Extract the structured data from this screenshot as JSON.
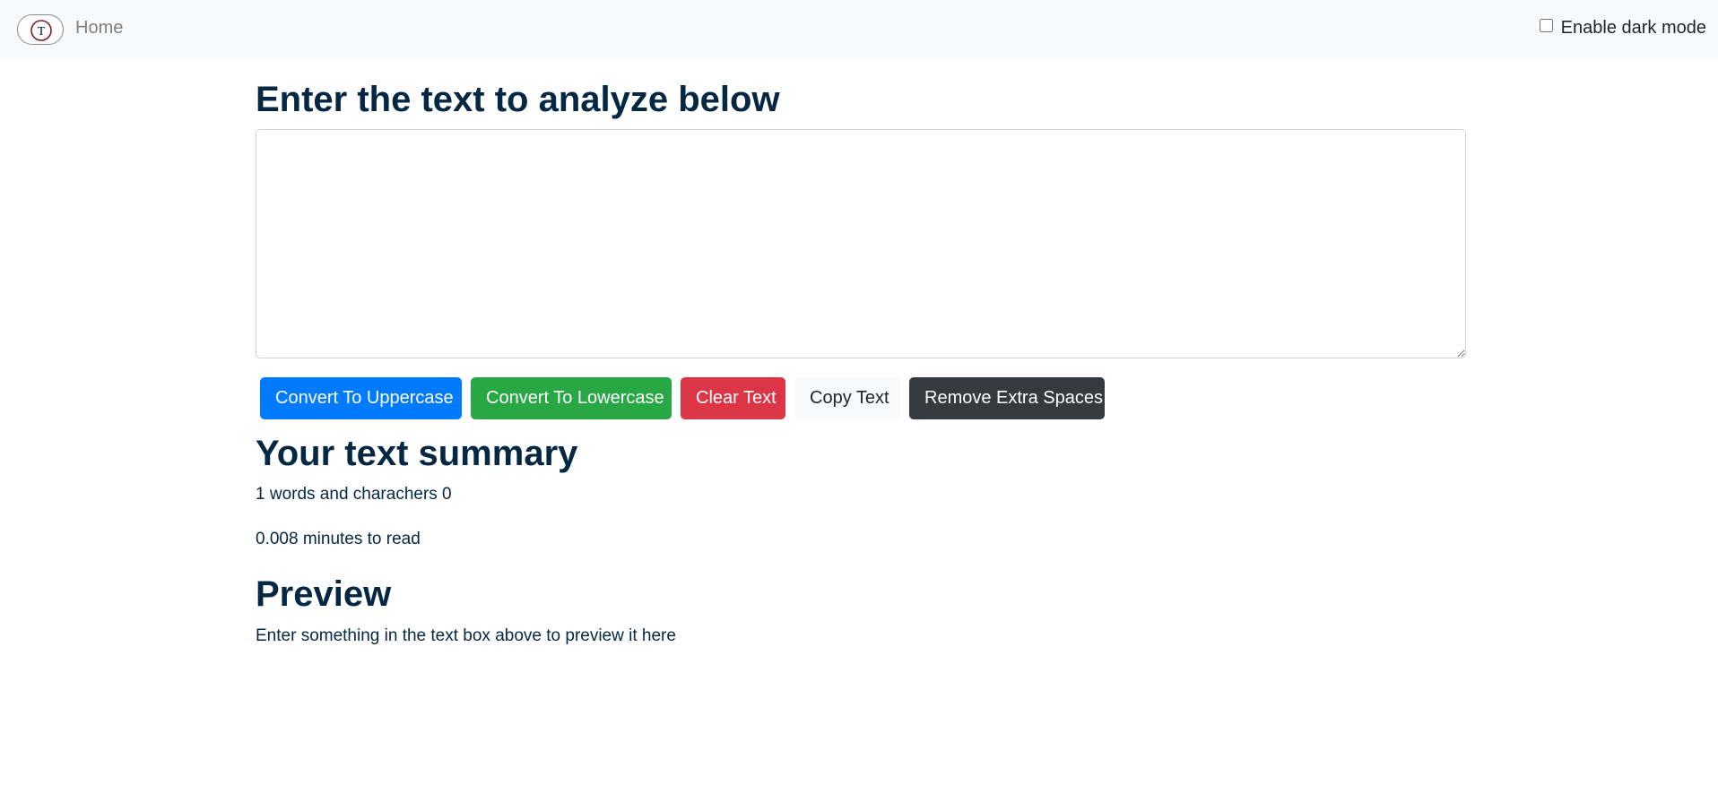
{
  "navbar": {
    "logo_icon": "text-utils-logo-icon",
    "logo_letter": "T",
    "home_label": "Home",
    "dark_mode_label": "Enable dark mode",
    "dark_mode_checked": false
  },
  "main": {
    "heading": "Enter the text to analyze below",
    "textarea_value": "",
    "buttons": {
      "uppercase": "Convert To Uppercase",
      "lowercase": "Convert To Lowercase",
      "clear": "Clear Text",
      "copy": "Copy Text",
      "remove_spaces": "Remove Extra Spaces"
    }
  },
  "summary": {
    "heading": "Your text summary",
    "words_line": "1 words and charachers 0",
    "read_time_line": "0.008 minutes to read"
  },
  "preview": {
    "heading": "Preview",
    "text": "Enter something in the text box above to preview it here"
  },
  "colors": {
    "primary": "#007bff",
    "success": "#28a745",
    "danger": "#dc3545",
    "light": "#f8f9fa",
    "dark": "#343a40",
    "heading_text": "#042743"
  }
}
